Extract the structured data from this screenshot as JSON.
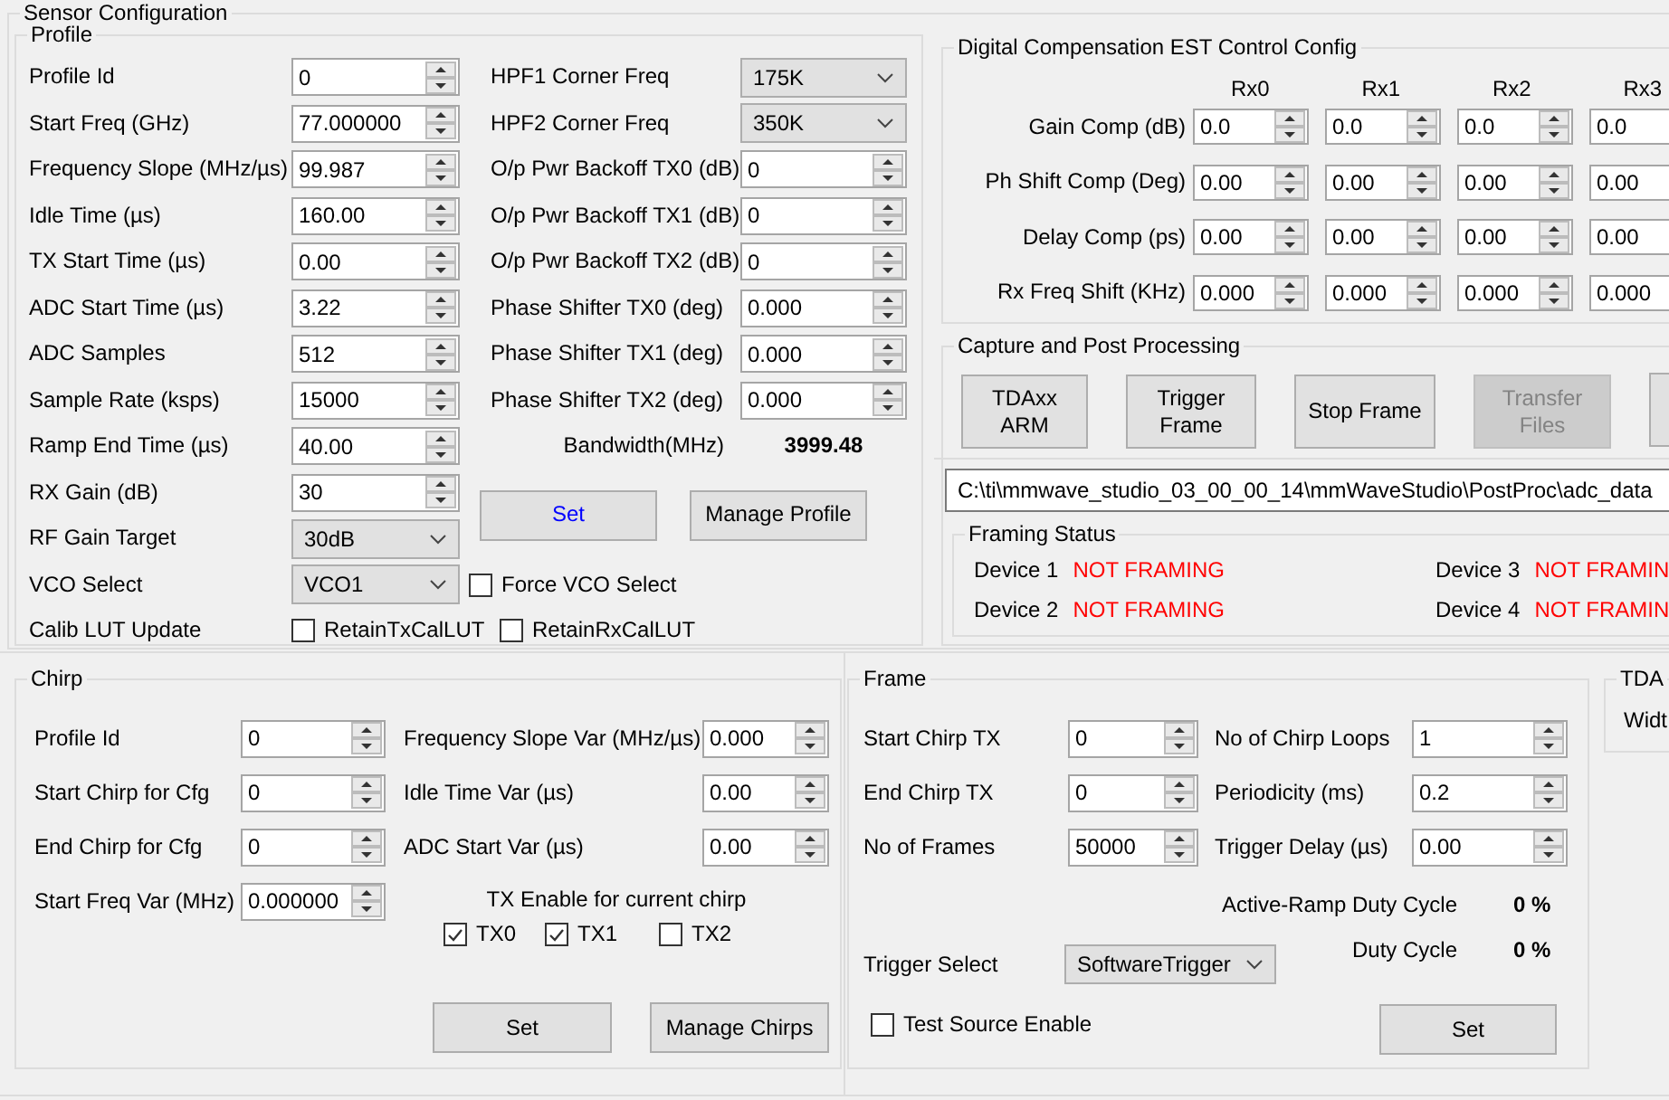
{
  "window": {
    "title": "Sensor Configuration"
  },
  "profile": {
    "title": "Profile",
    "left": [
      {
        "label": "Profile Id",
        "kind": "spin",
        "value": "0"
      },
      {
        "label": "Start Freq (GHz)",
        "kind": "spin",
        "value": "77.000000"
      },
      {
        "label": "Frequency Slope (MHz/µs)",
        "kind": "spin",
        "value": "99.987"
      },
      {
        "label": "Idle Time (µs)",
        "kind": "spin",
        "value": "160.00"
      },
      {
        "label": "TX Start Time (µs)",
        "kind": "spin",
        "value": "0.00"
      },
      {
        "label": "ADC Start Time (µs)",
        "kind": "spin",
        "value": "3.22"
      },
      {
        "label": "ADC Samples",
        "kind": "spin",
        "value": "512"
      },
      {
        "label": "Sample Rate (ksps)",
        "kind": "spin",
        "value": "15000"
      },
      {
        "label": "Ramp End Time (µs)",
        "kind": "spin",
        "value": "40.00"
      },
      {
        "label": "RX Gain (dB)",
        "kind": "spin",
        "value": "30"
      },
      {
        "label": "RF Gain Target",
        "kind": "combo",
        "value": "30dB"
      },
      {
        "label": "VCO Select",
        "kind": "combo",
        "value": "VCO1"
      }
    ],
    "right": [
      {
        "label": "HPF1 Corner Freq",
        "kind": "combo",
        "value": "175K"
      },
      {
        "label": "HPF2 Corner Freq",
        "kind": "combo",
        "value": "350K"
      },
      {
        "label": "O/p Pwr Backoff TX0 (dB)",
        "kind": "spin",
        "value": "0"
      },
      {
        "label": "O/p Pwr Backoff TX1 (dB)",
        "kind": "spin",
        "value": "0"
      },
      {
        "label": "O/p Pwr Backoff TX2 (dB)",
        "kind": "spin",
        "value": "0"
      },
      {
        "label": "Phase Shifter TX0 (deg)",
        "kind": "spin",
        "value": "0.000"
      },
      {
        "label": "Phase Shifter TX1 (deg)",
        "kind": "spin",
        "value": "0.000"
      },
      {
        "label": "Phase Shifter TX2 (deg)",
        "kind": "spin",
        "value": "0.000"
      }
    ],
    "bandwidth": {
      "label": "Bandwidth(MHz)",
      "value": "3999.48"
    },
    "buttons": [
      {
        "label": "Set",
        "focused": true
      },
      {
        "label": "Manage Profile",
        "focused": false
      }
    ],
    "force_vco": {
      "label": "Force VCO Select",
      "checked": false
    },
    "calib": {
      "label": "Calib LUT Update",
      "options": [
        {
          "label": "RetainTxCalLUT",
          "checked": false
        },
        {
          "label": "RetainRxCalLUT",
          "checked": false
        }
      ]
    }
  },
  "digital_compensation": {
    "title": "Digital Compensation EST Control Config",
    "columns": [
      "Rx0",
      "Rx1",
      "Rx2",
      "Rx3"
    ],
    "rows": [
      {
        "label": "Gain Comp (dB)",
        "values": [
          "0.0",
          "0.0",
          "0.0",
          "0.0"
        ]
      },
      {
        "label": "Ph Shift Comp (Deg)",
        "values": [
          "0.00",
          "0.00",
          "0.00",
          "0.00"
        ]
      },
      {
        "label": "Delay Comp (ps)",
        "values": [
          "0.00",
          "0.00",
          "0.00",
          "0.00"
        ]
      },
      {
        "label": "Rx Freq Shift (KHz)",
        "values": [
          "0.000",
          "0.000",
          "0.000",
          "0.000"
        ]
      }
    ]
  },
  "capture": {
    "title": "Capture and Post Processing",
    "buttons": [
      {
        "label": "TDAxx ARM",
        "disabled": false
      },
      {
        "label": "Trigger Frame",
        "disabled": false
      },
      {
        "label": "Stop Frame",
        "disabled": false
      },
      {
        "label": "Transfer Files",
        "disabled": true
      },
      {
        "disabled": false
      }
    ],
    "path": "C:\\ti\\mmwave_studio_03_00_00_14\\mmWaveStudio\\PostProc\\adc_data",
    "framing": {
      "title": "Framing Status",
      "devices": [
        {
          "label": "Device 1",
          "status": "NOT FRAMING"
        },
        {
          "label": "Device 2",
          "status": "NOT FRAMING"
        },
        {
          "label": "Device 3",
          "status": "NOT FRAMIN"
        },
        {
          "label": "Device 4",
          "status": "NOT FRAMIN"
        }
      ]
    }
  },
  "chirp": {
    "title": "Chirp",
    "left": [
      {
        "label": "Profile Id",
        "value": "0"
      },
      {
        "label": "Start Chirp for Cfg",
        "value": "0"
      },
      {
        "label": "End Chirp for Cfg",
        "value": "0"
      },
      {
        "label": "Start Freq Var (MHz)",
        "value": "0.000000"
      }
    ],
    "right": [
      {
        "label": "Frequency Slope Var (MHz/µs)",
        "value": "0.000"
      },
      {
        "label": "Idle Time Var (µs)",
        "value": "0.00"
      },
      {
        "label": "ADC Start Var (µs)",
        "value": "0.00"
      }
    ],
    "tx_enable": {
      "label": "TX Enable for current chirp",
      "options": [
        {
          "label": "TX0",
          "checked": true
        },
        {
          "label": "TX1",
          "checked": true
        },
        {
          "label": "TX2",
          "checked": false
        }
      ]
    },
    "buttons": [
      "Set",
      "Manage Chirps"
    ]
  },
  "frame": {
    "title": "Frame",
    "left": [
      {
        "label": "Start Chirp TX",
        "value": "0"
      },
      {
        "label": "End Chirp TX",
        "value": "0"
      },
      {
        "label": "No of Frames",
        "value": "50000"
      }
    ],
    "right": [
      {
        "label": "No of Chirp Loops",
        "value": "1"
      },
      {
        "label": "Periodicity (ms)",
        "value": "0.2"
      },
      {
        "label": "Trigger Delay (µs)",
        "value": "0.00"
      }
    ],
    "active_ramp_duty_cycle": {
      "label": "Active-Ramp Duty Cycle",
      "value": "0 %"
    },
    "duty_cycle": {
      "label": "Duty Cycle",
      "value": "0 %"
    },
    "trigger_select": {
      "label": "Trigger Select",
      "value": "SoftwareTrigger"
    },
    "test_source": {
      "label": "Test Source Enable",
      "checked": false
    },
    "buttons": [
      "Set"
    ]
  },
  "tda": {
    "title": "TDA",
    "label": "Widt"
  }
}
